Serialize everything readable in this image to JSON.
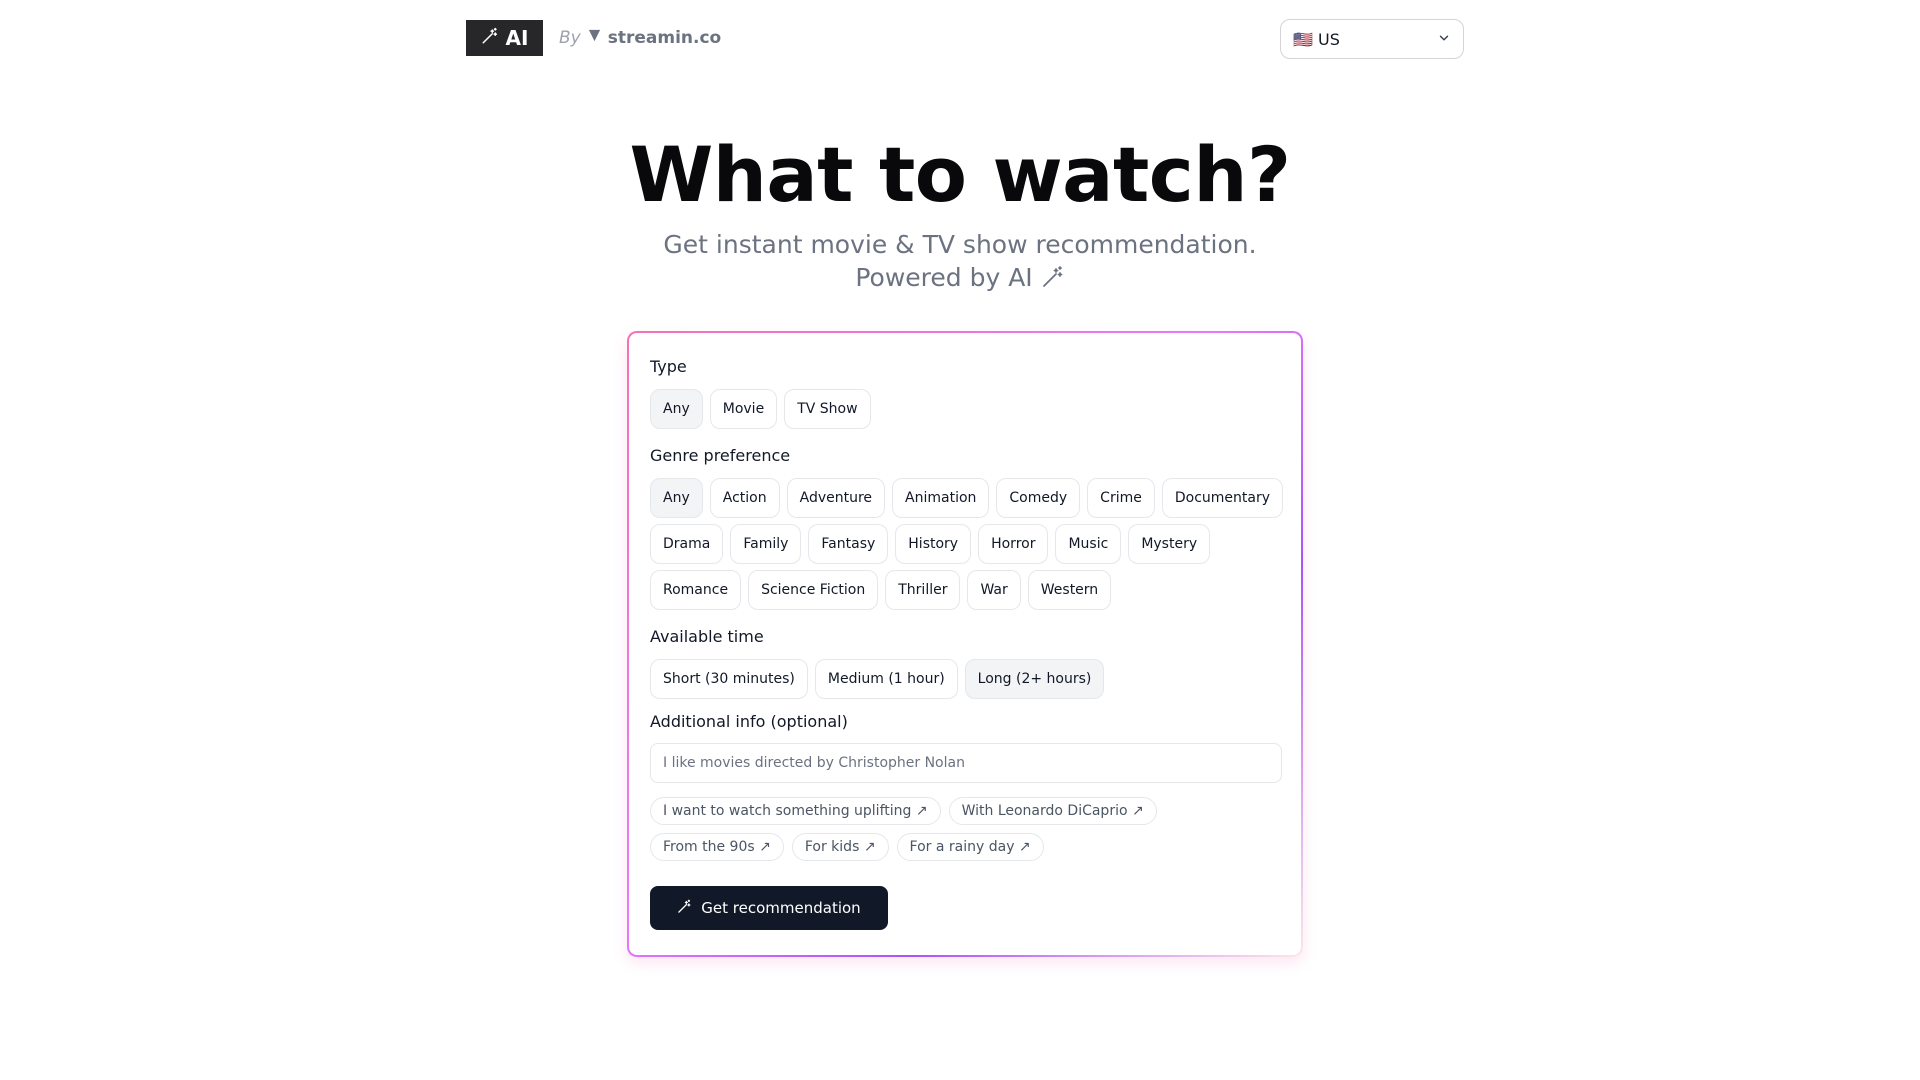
{
  "header": {
    "logo_text": "AI",
    "by": "By",
    "brand": "streamin.co",
    "country": "🇺🇸 US"
  },
  "hero": {
    "title": "What to watch?",
    "subtitle_line1": "Get instant movie & TV show recommendation.",
    "subtitle_line2": "Powered by AI"
  },
  "form": {
    "type_label": "Type",
    "types": [
      {
        "label": "Any",
        "selected": true
      },
      {
        "label": "Movie",
        "selected": false
      },
      {
        "label": "TV Show",
        "selected": false
      }
    ],
    "genre_label": "Genre preference",
    "genres_row1": [
      {
        "label": "Any",
        "selected": true
      },
      {
        "label": "Action"
      },
      {
        "label": "Adventure"
      },
      {
        "label": "Animation"
      },
      {
        "label": "Comedy"
      },
      {
        "label": "Crime"
      },
      {
        "label": "Documentary"
      }
    ],
    "genres_row2": [
      {
        "label": "Drama"
      },
      {
        "label": "Family"
      },
      {
        "label": "Fantasy"
      },
      {
        "label": "History"
      },
      {
        "label": "Horror"
      },
      {
        "label": "Music"
      },
      {
        "label": "Mystery"
      }
    ],
    "genres_row3": [
      {
        "label": "Romance"
      },
      {
        "label": "Science Fiction"
      },
      {
        "label": "Thriller"
      },
      {
        "label": "War"
      },
      {
        "label": "Western"
      }
    ],
    "time_label": "Available time",
    "times": [
      {
        "label": "Short (30 minutes)",
        "selected": false
      },
      {
        "label": "Medium (1 hour)",
        "selected": false
      },
      {
        "label": "Long (2+ hours)",
        "selected": true
      }
    ],
    "info_label": "Additional info (optional)",
    "info_placeholder": "I like movies directed by Christopher Nolan",
    "suggestions_row1": [
      "I want to watch something uplifting ↗",
      "With Leonardo DiCaprio ↗"
    ],
    "suggestions_row2": [
      "From the 90s ↗",
      "For kids ↗",
      "For a rainy day ↗"
    ],
    "submit_label": "Get recommendation"
  }
}
